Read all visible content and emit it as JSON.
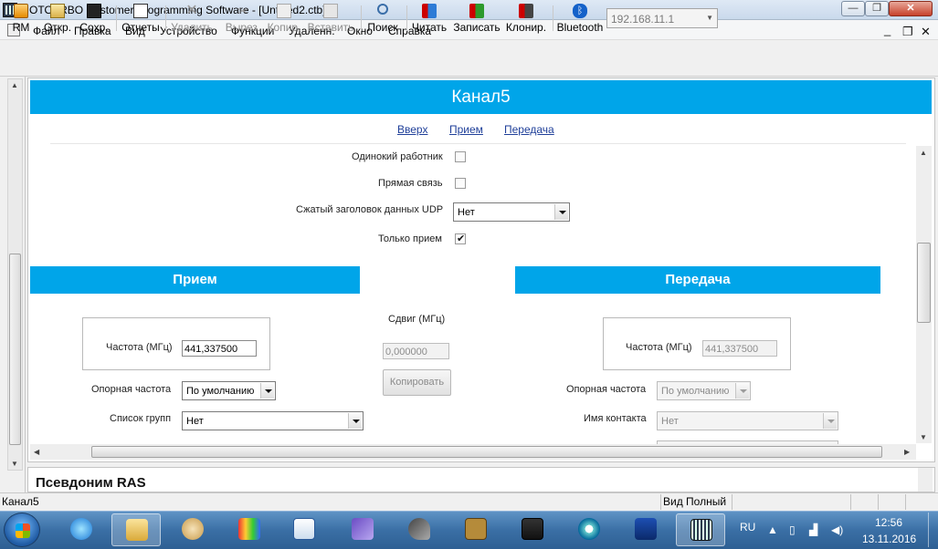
{
  "window": {
    "title": "MOTOTRBO Customer Programming Software - [Untitled2.ctb]",
    "min_glyph": "—",
    "max_glyph": "❐",
    "close_glyph": "✕"
  },
  "menu": {
    "items": [
      "Файл",
      "Правка",
      "Вид",
      "Устройство",
      "Функции",
      "Удаленн.",
      "Окно",
      "Справка"
    ],
    "mdi": {
      "min": "_",
      "restore": "❐",
      "close": "✕"
    }
  },
  "toolbar": {
    "buttons": [
      {
        "label": "RM",
        "icon": "rm-icon",
        "disabled": false
      },
      {
        "label": "Откр.",
        "icon": "open-folder-icon",
        "disabled": false
      },
      {
        "label": "Сохр.",
        "icon": "save-disk-icon",
        "disabled": false
      },
      {
        "label": "Отчеты",
        "icon": "report-icon",
        "disabled": false
      },
      {
        "label": "Удалить",
        "icon": "delete-x-icon",
        "disabled": true
      },
      {
        "label": "Вырез.",
        "icon": "cut-icon",
        "disabled": true
      },
      {
        "label": "Копир.",
        "icon": "copy-icon",
        "disabled": true
      },
      {
        "label": "Вставить",
        "icon": "paste-icon",
        "disabled": true
      },
      {
        "label": "Поиск",
        "icon": "search-icon",
        "disabled": false
      },
      {
        "label": "Читать",
        "icon": "read-radio-icon",
        "disabled": false
      },
      {
        "label": "Записать",
        "icon": "write-radio-icon",
        "disabled": false
      },
      {
        "label": "Клонир.",
        "icon": "clone-radio-icon",
        "disabled": false
      },
      {
        "label": "Bluetooth",
        "icon": "bluetooth-icon",
        "disabled": false
      }
    ],
    "ip_address": "192.168.11.1"
  },
  "channel": {
    "title": "Канал5",
    "nav_links": [
      "Вверх",
      "Прием",
      "Передача"
    ],
    "lone_worker_label": "Одинокий работник",
    "lone_worker_checked": false,
    "talkaround_label": "Прямая связь",
    "talkaround_checked": false,
    "udp_header_label": "Сжатый заголовок данных UDP",
    "udp_header_value": "Нет",
    "rx_only_label": "Только прием",
    "rx_only_checked": true
  },
  "rx": {
    "header": "Прием",
    "freq_label": "Частота (МГц)",
    "freq_value": "441,337500",
    "ref_freq_label": "Опорная частота",
    "ref_freq_value": "По умолчанию",
    "group_list_label": "Список групп",
    "group_list_value": "Нет"
  },
  "offset": {
    "label": "Сдвиг (МГц)",
    "value": "0,000000",
    "copy_button": "Копировать"
  },
  "tx": {
    "header": "Передача",
    "freq_label": "Частота (МГц)",
    "freq_value": "441,337500",
    "ref_freq_label": "Опорная частота",
    "ref_freq_value": "По умолчанию",
    "contact_label": "Имя контакта",
    "contact_value": "Нет"
  },
  "bottom_pane": {
    "title": "Псевдоним RAS"
  },
  "statusbar": {
    "left": "Канал5",
    "view": "Вид Полный"
  },
  "taskbar": {
    "lang": "RU",
    "time": "12:56",
    "date": "13.11.2016"
  },
  "colors": {
    "accent": "#00a5e9",
    "link": "#1f3f99"
  }
}
